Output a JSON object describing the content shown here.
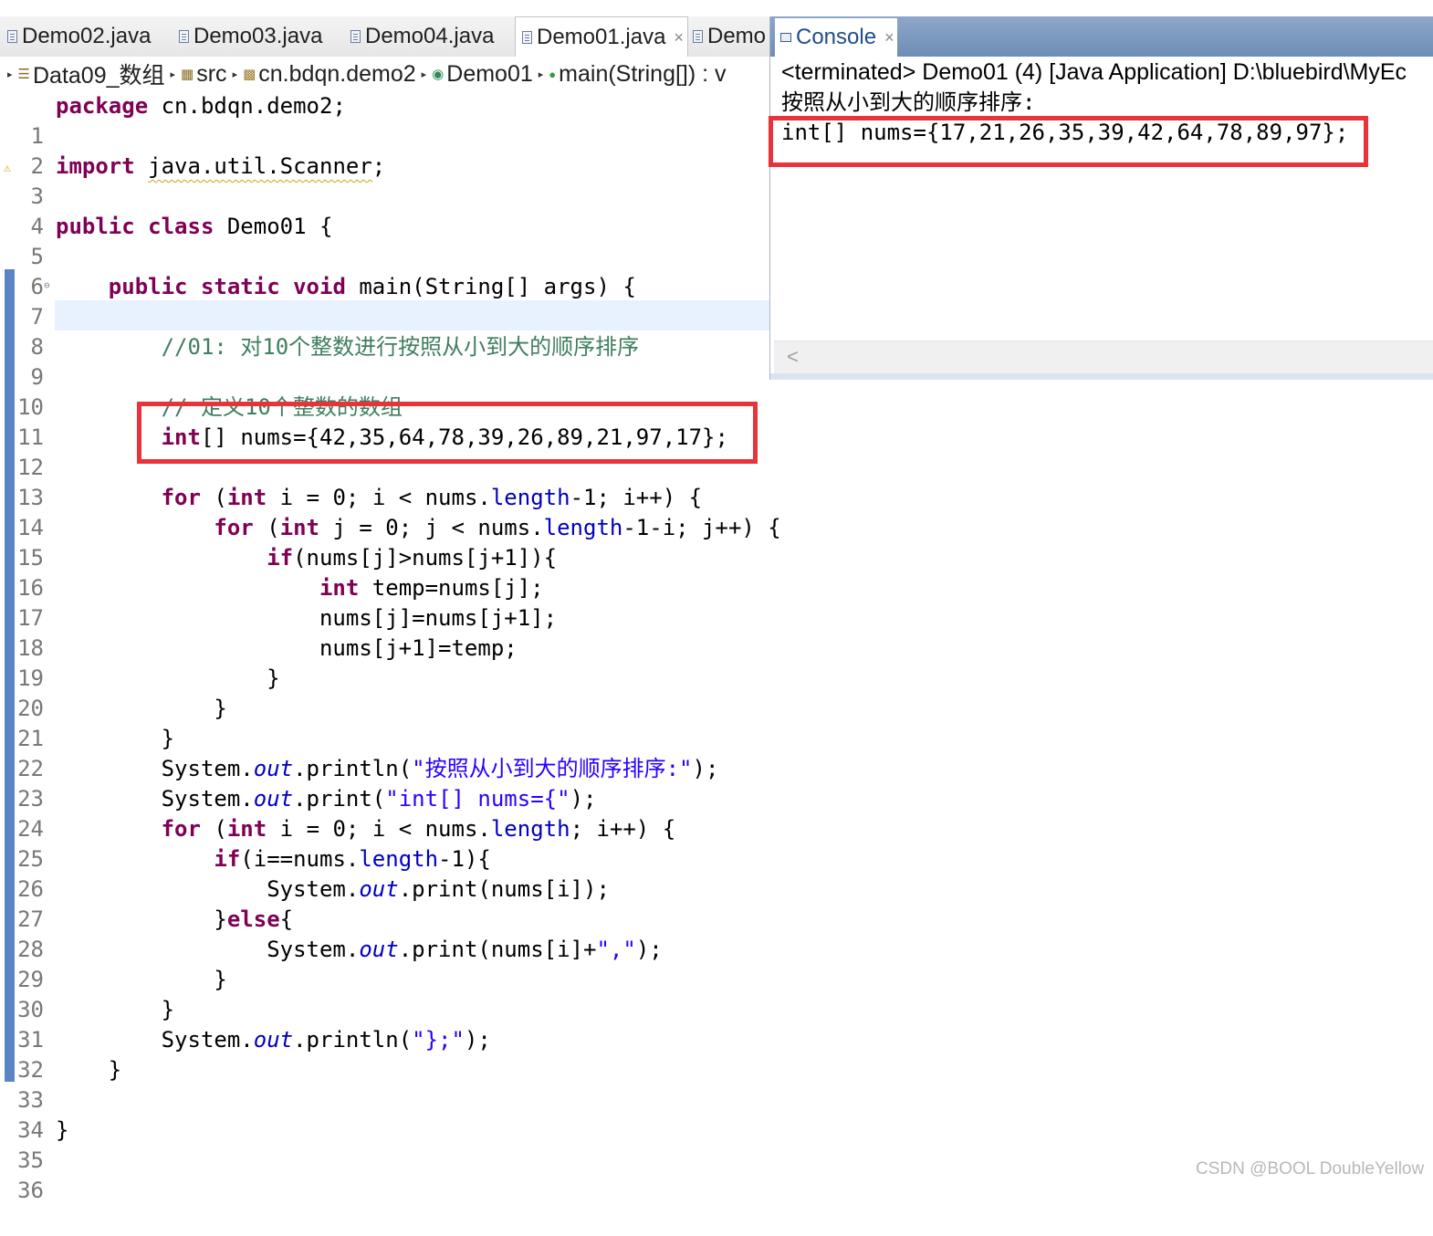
{
  "editor_tabs": [
    {
      "label": "Demo02.java",
      "active": false
    },
    {
      "label": "Demo03.java",
      "active": false
    },
    {
      "label": "Demo04.java",
      "active": false
    },
    {
      "label": "Demo01.java",
      "active": true
    },
    {
      "label": "Demo",
      "active": false
    }
  ],
  "editor_tab_close": "×",
  "breadcrumb": {
    "project": "Data09_数组",
    "folder": "src",
    "package": "cn.bdqn.demo2",
    "class": "Demo01",
    "method": "main(String[]) : v"
  },
  "editor": {
    "line_numbers": [
      "1",
      "2",
      "3",
      "4",
      "5",
      "6",
      "7",
      "8",
      "9",
      "10",
      "11",
      "12",
      "13",
      "14",
      "15",
      "16",
      "17",
      "18",
      "19",
      "20",
      "21",
      "22",
      "23",
      "24",
      "25",
      "26",
      "27",
      "28",
      "29",
      "30",
      "31",
      "32",
      "33",
      "34",
      "35",
      "36"
    ],
    "strings": {
      "l23_str": "\"按照从小到大的顺序排序:\"",
      "l24_str": "\"int[] nums={\"",
      "l29_str": "\",\"",
      "l32_str": "\"};\""
    },
    "comments": {
      "l9": "//01: 对10个整数进行按照从小到大的顺序排序",
      "l11": "// 定义10个整数的数组"
    },
    "array_literal": "nums={42,35,64,78,39,26,89,21,97,17};"
  },
  "console": {
    "tab_label": "Console",
    "tab_close": "×",
    "header": "<terminated> Demo01 (4) [Java Application] D:\\bluebird\\MyEc",
    "output": [
      "按照从小到大的顺序排序:",
      "int[] nums={17,21,26,35,39,42,64,78,89,97};"
    ],
    "scroll_left": "<"
  },
  "watermark": "CSDN @BOOL DoubleYellow",
  "colors": {
    "keyword": "#7f0055",
    "comment": "#3f7f5f",
    "string": "#2a00ff",
    "field": "#0000c0",
    "highlight_box": "#e8333b",
    "console_tabbar": "#6f8db4"
  }
}
